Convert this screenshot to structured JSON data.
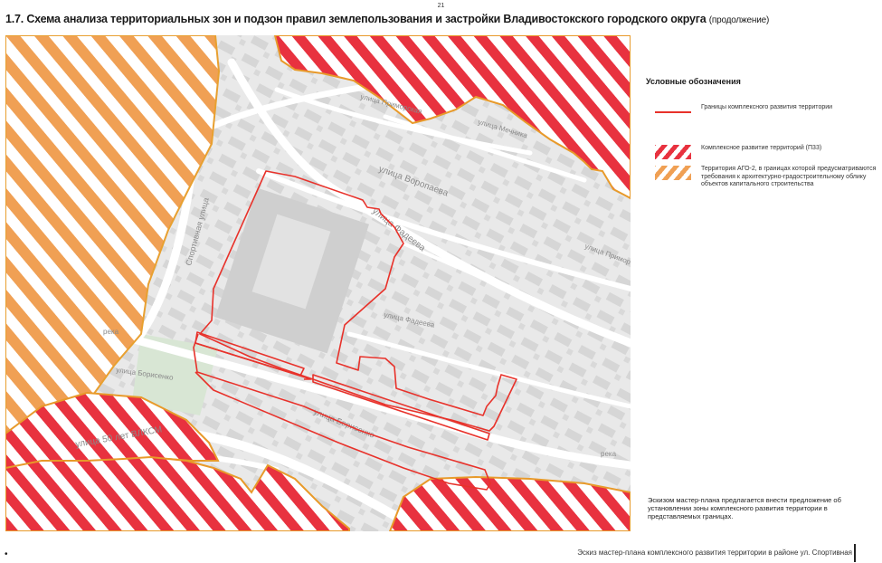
{
  "page_number": "21",
  "title": {
    "main": "1.7. Схема анализа территориальных зон и подзон правил землепользования и застройки Владивостокского городского округа",
    "suffix": "(продолжение)"
  },
  "legend": {
    "title": "Условные обозначения",
    "items": [
      {
        "label": "Границы комплексного развития территории",
        "symbol": "red-line",
        "color": "#e8322b"
      },
      {
        "label": "Комплексное развитие территорий (П33)",
        "symbol": "red-hatch",
        "color": "#e8323f"
      },
      {
        "label": "Территория АГО-2, в границах которой предусматриваются требования к архитектурно-градостроительному облику объектов капитального строительства",
        "symbol": "orange-hatch",
        "color": "#f0a054"
      }
    ]
  },
  "map": {
    "street_labels": [
      {
        "text": "улица Приморская"
      },
      {
        "text": "улица Мечника"
      },
      {
        "text": "улица Воропаева"
      },
      {
        "text": "улица Фадеева"
      },
      {
        "text": "улица Фадеева"
      },
      {
        "text": "Спортивная улица"
      },
      {
        "text": "улица Борисенко"
      },
      {
        "text": "улица Борисенко"
      },
      {
        "text": "улица 50 лет ВЛКСМ"
      },
      {
        "text": "улица Приморская"
      },
      {
        "text": "река"
      },
      {
        "text": "река"
      }
    ]
  },
  "note": "Эскизом  мастер-плана предлагается внести предложение об установлении зоны комплексного развития территории в представляемых границах.",
  "footer": {
    "bullet": "•",
    "caption": "Эскиз мастер-плана комплексного развития территории  в районе ул. Спортивная"
  }
}
